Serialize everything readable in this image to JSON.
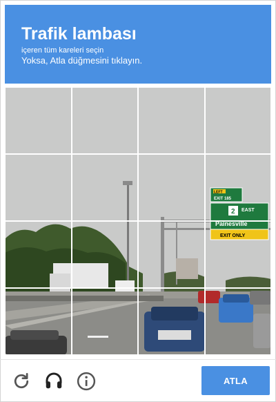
{
  "header": {
    "title": "Trafik lambası",
    "instruction": "içeren tüm kareleri seçin",
    "skip_hint": "Yoksa, Atla düğmesini tıklayın."
  },
  "grid": {
    "rows": 4,
    "cols": 4
  },
  "signs": {
    "left_tag": "LEFT",
    "exit": "EXIT 185",
    "route": "2",
    "direction": "EAST",
    "city": "Painesville",
    "exit_only": "EXIT ONLY"
  },
  "footer": {
    "reload_icon": "reload-icon",
    "audio_icon": "headphones-icon",
    "info_icon": "info-icon",
    "skip_label": "ATLA"
  },
  "colors": {
    "accent": "#4a90e2",
    "icon": "#555555",
    "sky": "#c8c9c8",
    "sign_green": "#1f7a3e",
    "sign_yellow": "#f0c419"
  }
}
